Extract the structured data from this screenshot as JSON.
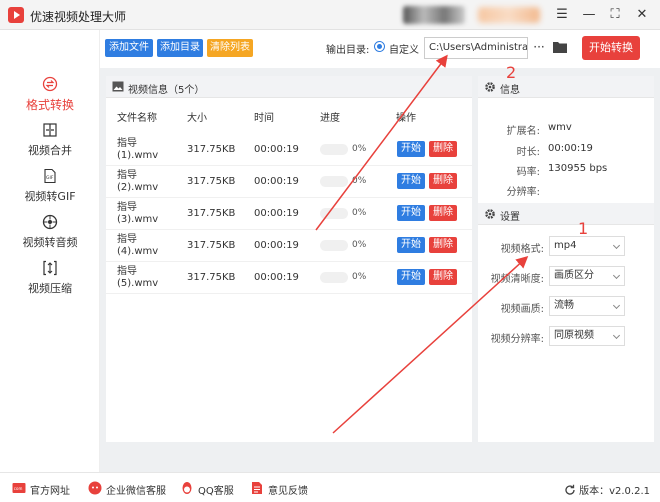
{
  "window": {
    "title": "优速视频处理大师",
    "menu_glyph": "☰",
    "minimize_glyph": "—",
    "fullscreen_glyph": "⛶",
    "close_glyph": "✕"
  },
  "sidebar": {
    "items": [
      {
        "label": "格式转换",
        "icon": "format-convert-icon",
        "active": true
      },
      {
        "label": "视频合并",
        "icon": "merge-icon",
        "active": false
      },
      {
        "label": "视频转GIF",
        "icon": "gif-icon",
        "active": false
      },
      {
        "label": "视频转音频",
        "icon": "audio-icon",
        "active": false
      },
      {
        "label": "视频压缩",
        "icon": "compress-icon",
        "active": false
      }
    ]
  },
  "toolbar": {
    "add_file": "添加文件",
    "add_dir": "添加目录",
    "clear_list": "清除列表",
    "output_label": "输出目录:",
    "custom_label": "自定义",
    "output_path": "C:\\Users\\Administrator\\",
    "more": "···",
    "start_all": "开始转换"
  },
  "file_panel": {
    "title": "视频信息（5个）",
    "columns": [
      "文件名称",
      "大小",
      "时间",
      "进度",
      "操作"
    ],
    "rows": [
      {
        "name": "指导 (1).wmv",
        "size": "317.75KB",
        "time": "00:00:19",
        "progress": "0%",
        "progress_value": 0
      },
      {
        "name": "指导 (2).wmv",
        "size": "317.75KB",
        "time": "00:00:19",
        "progress": "0%",
        "progress_value": 0
      },
      {
        "name": "指导 (3).wmv",
        "size": "317.75KB",
        "time": "00:00:19",
        "progress": "0%",
        "progress_value": 0
      },
      {
        "name": "指导 (4).wmv",
        "size": "317.75KB",
        "time": "00:00:19",
        "progress": "0%",
        "progress_value": 0
      },
      {
        "name": "指导 (5).wmv",
        "size": "317.75KB",
        "time": "00:00:19",
        "progress": "0%",
        "progress_value": 0
      }
    ],
    "start_label": "开始",
    "delete_label": "删除"
  },
  "info": {
    "title": "信息",
    "ext_label": "扩展名:",
    "ext_value": "wmv",
    "duration_label": "时长:",
    "duration_value": "00:00:19",
    "bitrate_label": "码率:",
    "bitrate_value": "130955 bps",
    "resolution_label": "分辨率:",
    "resolution_value": ""
  },
  "settings": {
    "title": "设置",
    "format_label": "视频格式:",
    "format_value": "mp4",
    "clarity_label": "视频清晰度:",
    "clarity_value": "画质区分",
    "quality_label": "视频画质:",
    "quality_value": "流畅",
    "resolution_label": "视频分辨率:",
    "resolution_value": "同原视频"
  },
  "footer": {
    "website": "官方网址",
    "wechat": "企业微信客服",
    "qq": "QQ客服",
    "feedback": "意见反馈",
    "version": "版本：v2.0.2.1"
  },
  "annotations": {
    "num1": "1",
    "num2": "2"
  },
  "colors": {
    "accent_red": "#e8413c",
    "button_blue": "#2f7de1",
    "button_orange": "#f5a623"
  }
}
